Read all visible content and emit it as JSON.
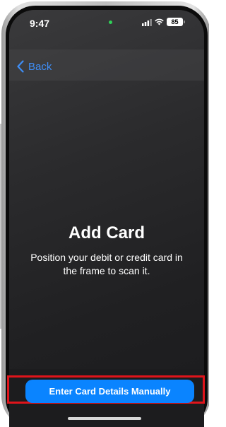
{
  "status_bar": {
    "time": "9:47",
    "battery_level": "85",
    "signal_icon": "cellular-signal-icon",
    "wifi_icon": "wifi-icon"
  },
  "nav": {
    "back_label": "Back",
    "back_icon": "chevron-left-icon"
  },
  "main": {
    "title": "Add Card",
    "instructions": "Position your debit or credit card in the frame to scan it."
  },
  "footer": {
    "manual_entry_label": "Enter Card Details Manually"
  },
  "colors": {
    "accent": "#0a84ff",
    "highlight": "#e0141b"
  }
}
